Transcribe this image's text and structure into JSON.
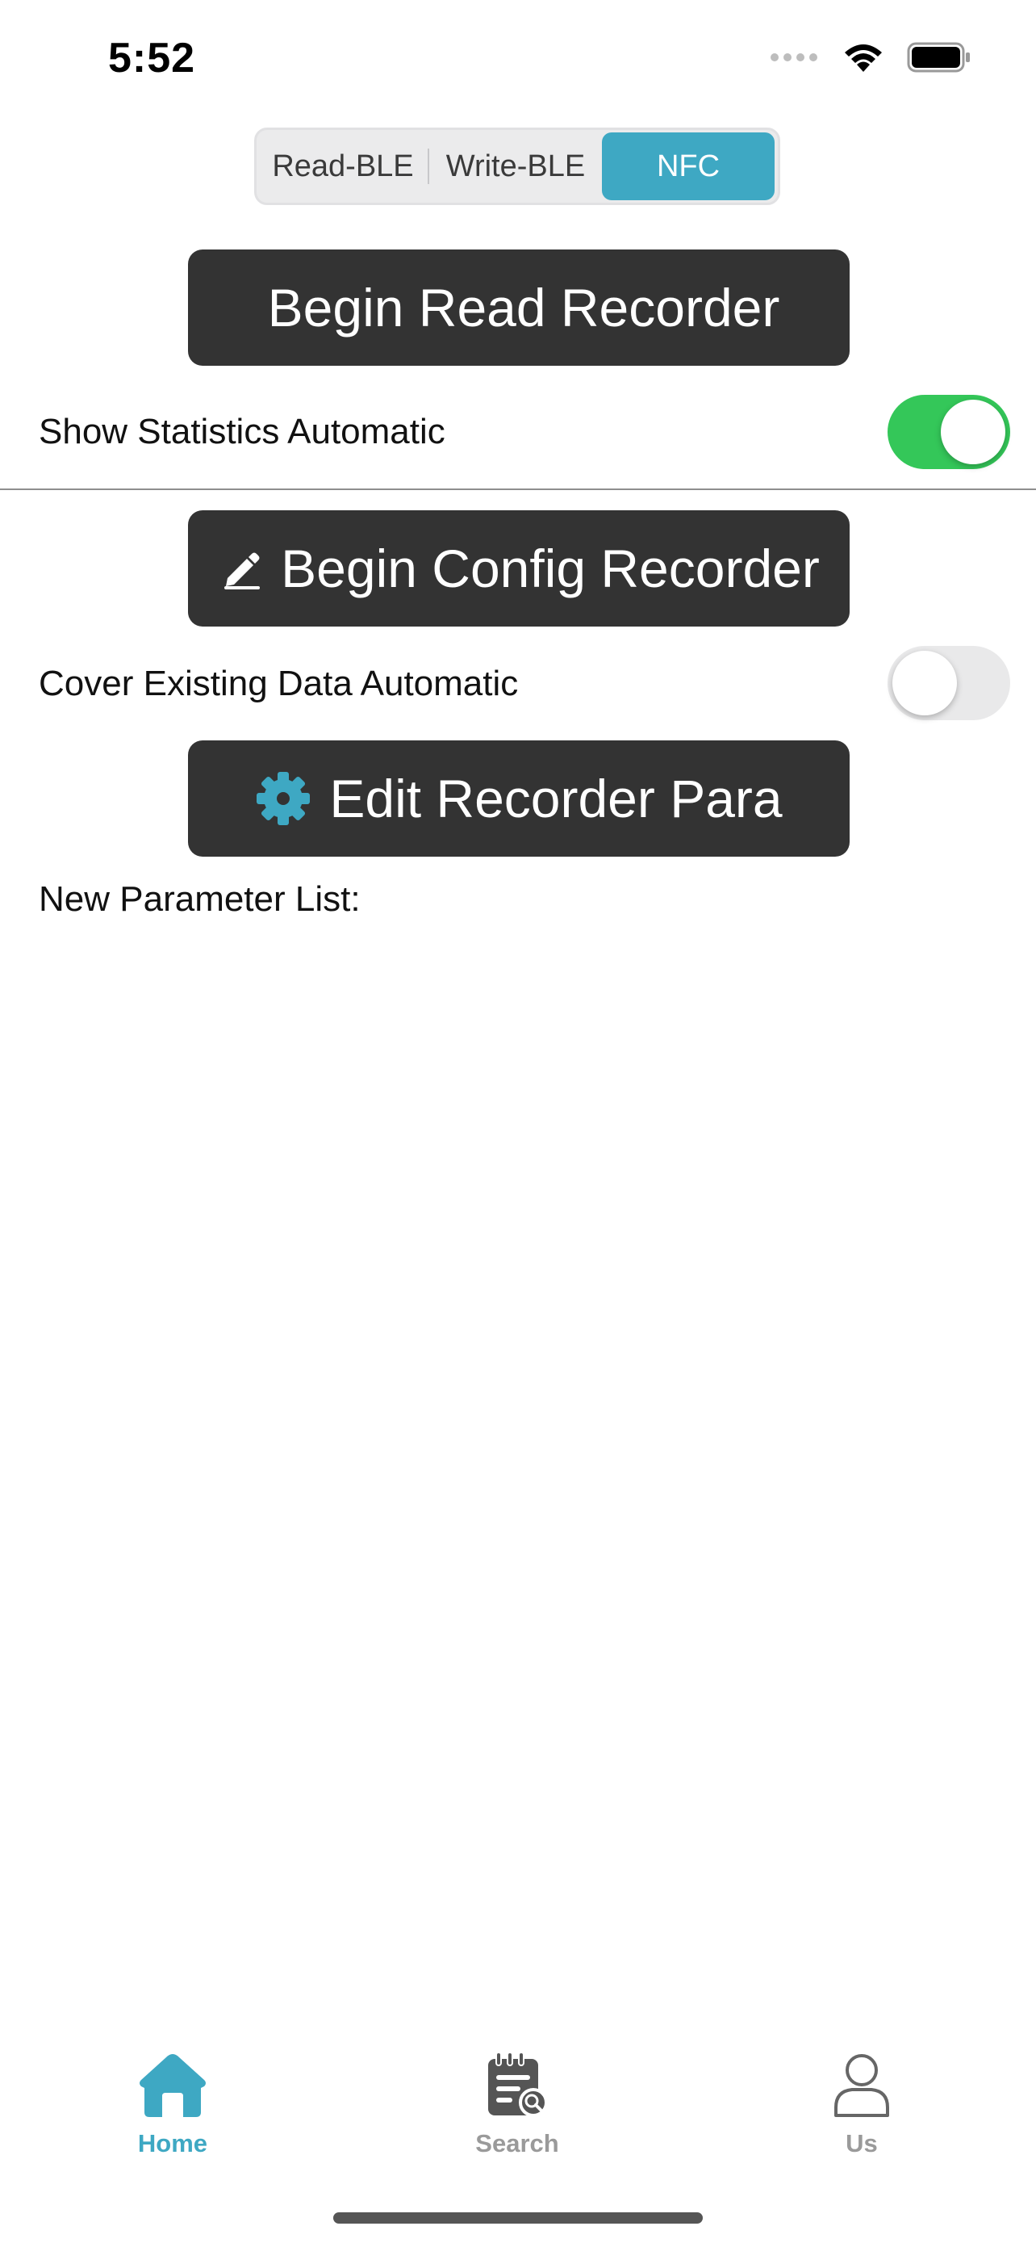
{
  "status_bar": {
    "time": "5:52",
    "icons": [
      "cellular-dots-icon",
      "wifi-icon",
      "battery-icon"
    ]
  },
  "segmented": {
    "items": [
      {
        "label": "Read-BLE",
        "selected": false
      },
      {
        "label": "Write-BLE",
        "selected": false
      },
      {
        "label": "NFC",
        "selected": true
      }
    ],
    "accent": "#3ea8c3"
  },
  "buttons": {
    "begin_read": "Begin Read Recorder",
    "begin_config": "Begin Config Recorder",
    "edit_para": "Edit Recorder Para"
  },
  "settings": {
    "show_statistics": {
      "label": "Show Statistics Automatic",
      "on": true
    },
    "cover_existing": {
      "label": "Cover Existing Data Automatic",
      "on": false
    }
  },
  "parameter_list": {
    "label": "New Parameter List:"
  },
  "tab_bar": {
    "items": [
      {
        "label": "Home",
        "icon": "home-icon",
        "active": true
      },
      {
        "label": "Search",
        "icon": "search-notepad-icon",
        "active": false
      },
      {
        "label": "Us",
        "icon": "person-icon",
        "active": false
      }
    ]
  },
  "colors": {
    "button_dark": "#333333",
    "toggle_on": "#34c759",
    "toggle_off": "#e9e9ea",
    "accent": "#3ea8c3"
  }
}
